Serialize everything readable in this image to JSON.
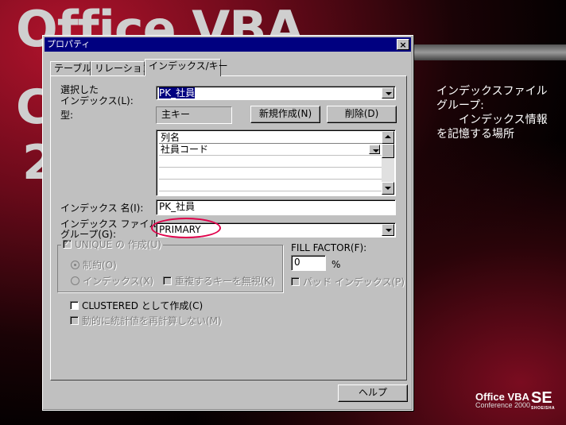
{
  "slide": {
    "background_title": "Office VBA",
    "big_letter_c": "C",
    "big_digit_2": "2",
    "annotation": "インデックスファイルグループ:\n　　インデックス情報を記憶する場所",
    "logo_main": "Office VBA",
    "logo_sub": "Conference 2000",
    "logo_se": "SE",
    "logo_publisher": "SHOEISHA"
  },
  "dialog": {
    "title": "プロパティ",
    "close_glyph": "×",
    "tabs": [
      "テーブル",
      "リレーション",
      "インデックス/キー"
    ],
    "selected_index_label": "選択した\nインデックス(L):",
    "selected_index_value": "PK_社員",
    "type_label": "型:",
    "type_value": "主キー",
    "new_button": "新規作成(N)",
    "delete_button": "削除(D)",
    "grid": {
      "header": "列名",
      "rows": [
        "社員コード"
      ]
    },
    "index_name_label": "インデックス 名(I):",
    "index_name_value": "PK_社員",
    "filegroup_label": "インデックス ファイル\nグループ(G):",
    "filegroup_value": "PRIMARY",
    "unique_group_label": "UNIQUE の 作成(U)",
    "constraint_label": "制約(O)",
    "index_option_label": "インデックス(X)",
    "ignore_dup_label": "重複するキーを無視(K)",
    "fill_factor_label": "FILL FACTOR(F):",
    "fill_factor_value": "0",
    "fill_factor_unit": "%",
    "pad_index_label": "パッド インデックス(P)",
    "clustered_label": "CLUSTERED として作成(C)",
    "auto_stats_label": "動的に統計値を再計算しない(M)",
    "help_button": "ヘルプ"
  },
  "colors": {
    "accent_ellipse": "#e0004a",
    "titlebar": "#000080",
    "dialog_face": "#c0c0c0"
  }
}
